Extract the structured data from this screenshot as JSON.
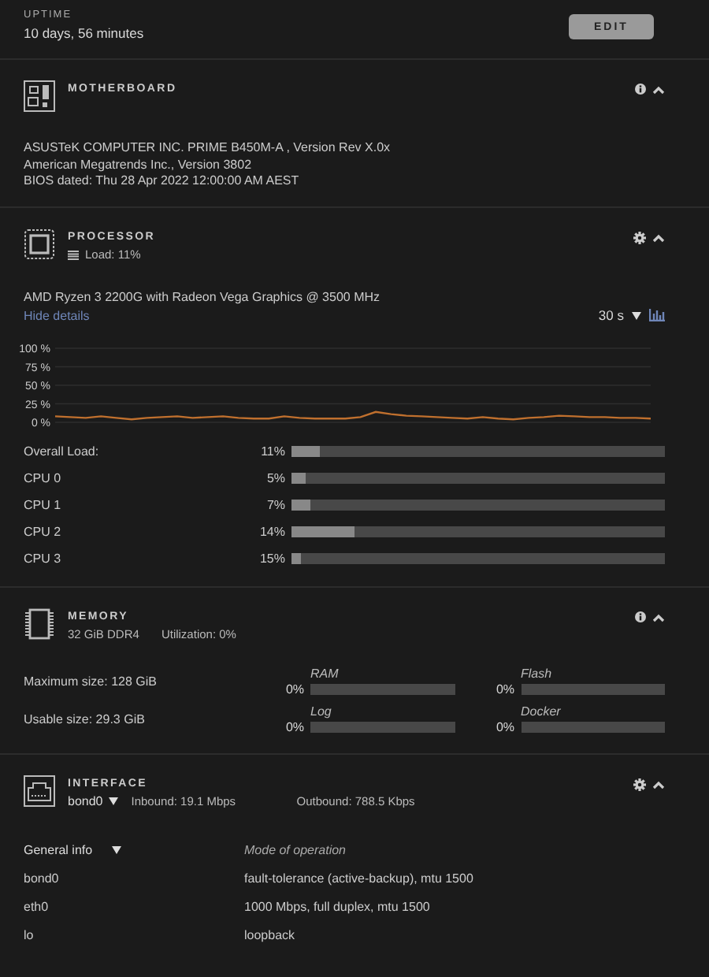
{
  "uptime": {
    "label": "UPTIME",
    "value": "10 days, 56 minutes"
  },
  "edit_button": "EDIT",
  "motherboard": {
    "title": "MOTHERBOARD",
    "lines": [
      "ASUSTeK COMPUTER INC. PRIME B450M-A , Version Rev X.0x",
      "American Megatrends Inc., Version 3802",
      "BIOS dated: Thu 28 Apr 2022 12:00:00 AM AEST"
    ]
  },
  "processor": {
    "title": "PROCESSOR",
    "load": "Load: 11%",
    "model": "AMD Ryzen 3 2200G with Radeon Vega Graphics @ 3500 MHz",
    "hide_details": "Hide details",
    "interval": "30 s",
    "chart_data": {
      "type": "line",
      "grid": true,
      "ylim": [
        0,
        100
      ],
      "yticks": [
        {
          "value": 0,
          "label": "0 %"
        },
        {
          "value": 25,
          "label": "25 %"
        },
        {
          "value": 50,
          "label": "50 %"
        },
        {
          "value": 75,
          "label": "75 %"
        },
        {
          "value": 100,
          "label": "100 %"
        }
      ],
      "series": [
        {
          "color": "#c0702e",
          "values": [
            8,
            7,
            6,
            8,
            6,
            4,
            6,
            7,
            8,
            6,
            7,
            8,
            6,
            5,
            5,
            8,
            6,
            5,
            5,
            5,
            7,
            14,
            11,
            9,
            8,
            7,
            6,
            5,
            7,
            5,
            4,
            6,
            7,
            9,
            8,
            7,
            7,
            6,
            6,
            5
          ]
        }
      ]
    },
    "loads": [
      {
        "label": "Overall Load:",
        "reading": "11%",
        "level": 0.074
      },
      {
        "label": "CPU 0",
        "reading": "5%",
        "level": 0.04
      },
      {
        "label": "CPU 1",
        "reading": "7%",
        "level": 0.05
      },
      {
        "label": "CPU 2",
        "reading": "14%",
        "level": 0.17
      },
      {
        "label": "CPU 3",
        "reading": "15%",
        "level": 0.026
      }
    ]
  },
  "memory": {
    "title": "MEMORY",
    "type": "32 GiB DDR4",
    "utilization": "Utilization: 0%",
    "sizes": [
      "Maximum size: 128 GiB",
      "Usable size: 29.3 GiB"
    ],
    "meters": [
      {
        "name": "RAM",
        "reading": "0%"
      },
      {
        "name": "Flash",
        "reading": "0%"
      },
      {
        "name": "Log",
        "reading": "0%"
      },
      {
        "name": "Docker",
        "reading": "0%"
      }
    ]
  },
  "interface": {
    "title": "INTERFACE",
    "selected": "bond0",
    "inbound": "Inbound: 19.1 Mbps",
    "outbound": "Outbound: 788.5 Kbps",
    "view": "General info",
    "column_header": "Mode of operation",
    "rows": [
      {
        "name": "bond0",
        "value": "fault-tolerance (active-backup), mtu 1500"
      },
      {
        "name": "eth0",
        "value": "1000 Mbps, full duplex, mtu 1500"
      },
      {
        "name": "lo",
        "value": "loopback"
      }
    ]
  }
}
